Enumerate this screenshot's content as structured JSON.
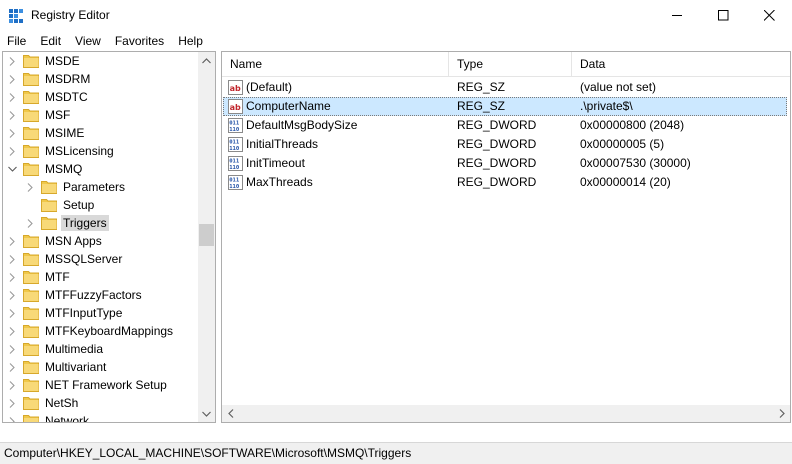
{
  "window": {
    "title": "Registry Editor"
  },
  "menu": [
    "File",
    "Edit",
    "View",
    "Favorites",
    "Help"
  ],
  "tree": [
    {
      "label": "MSDE",
      "depth": 0,
      "expander": "collapsed"
    },
    {
      "label": "MSDRM",
      "depth": 0,
      "expander": "collapsed"
    },
    {
      "label": "MSDTC",
      "depth": 0,
      "expander": "collapsed"
    },
    {
      "label": "MSF",
      "depth": 0,
      "expander": "collapsed"
    },
    {
      "label": "MSIME",
      "depth": 0,
      "expander": "collapsed"
    },
    {
      "label": "MSLicensing",
      "depth": 0,
      "expander": "collapsed"
    },
    {
      "label": "MSMQ",
      "depth": 0,
      "expander": "expanded"
    },
    {
      "label": "Parameters",
      "depth": 1,
      "expander": "collapsed"
    },
    {
      "label": "Setup",
      "depth": 1,
      "expander": "none"
    },
    {
      "label": "Triggers",
      "depth": 1,
      "expander": "collapsed",
      "selected": true
    },
    {
      "label": "MSN Apps",
      "depth": 0,
      "expander": "collapsed"
    },
    {
      "label": "MSSQLServer",
      "depth": 0,
      "expander": "collapsed"
    },
    {
      "label": "MTF",
      "depth": 0,
      "expander": "collapsed"
    },
    {
      "label": "MTFFuzzyFactors",
      "depth": 0,
      "expander": "collapsed"
    },
    {
      "label": "MTFInputType",
      "depth": 0,
      "expander": "collapsed"
    },
    {
      "label": "MTFKeyboardMappings",
      "depth": 0,
      "expander": "collapsed"
    },
    {
      "label": "Multimedia",
      "depth": 0,
      "expander": "collapsed"
    },
    {
      "label": "Multivariant",
      "depth": 0,
      "expander": "collapsed"
    },
    {
      "label": "NET Framework Setup",
      "depth": 0,
      "expander": "collapsed"
    },
    {
      "label": "NetSh",
      "depth": 0,
      "expander": "collapsed"
    },
    {
      "label": "Network",
      "depth": 0,
      "expander": "collapsed"
    }
  ],
  "columns": {
    "name": "Name",
    "type": "Type",
    "data": "Data"
  },
  "values": [
    {
      "name": "(Default)",
      "type": "REG_SZ",
      "data": "(value not set)",
      "icon": "string-value-icon"
    },
    {
      "name": "ComputerName",
      "type": "REG_SZ",
      "data": ".\\private$\\",
      "icon": "string-value-icon",
      "selected": true
    },
    {
      "name": "DefaultMsgBodySize",
      "type": "REG_DWORD",
      "data": "0x00000800 (2048)",
      "icon": "binary-value-icon"
    },
    {
      "name": "InitialThreads",
      "type": "REG_DWORD",
      "data": "0x00000005 (5)",
      "icon": "binary-value-icon"
    },
    {
      "name": "InitTimeout",
      "type": "REG_DWORD",
      "data": "0x00007530 (30000)",
      "icon": "binary-value-icon"
    },
    {
      "name": "MaxThreads",
      "type": "REG_DWORD",
      "data": "0x00000014 (20)",
      "icon": "binary-value-icon"
    }
  ],
  "status": {
    "path": "Computer\\HKEY_LOCAL_MACHINE\\SOFTWARE\\Microsoft\\MSMQ\\Triggers"
  },
  "colors": {
    "folder": "#f0c84a",
    "selection": "#cce8ff",
    "tree_selection": "#d9d9d9",
    "scrollbar": "#f0f0f0"
  }
}
